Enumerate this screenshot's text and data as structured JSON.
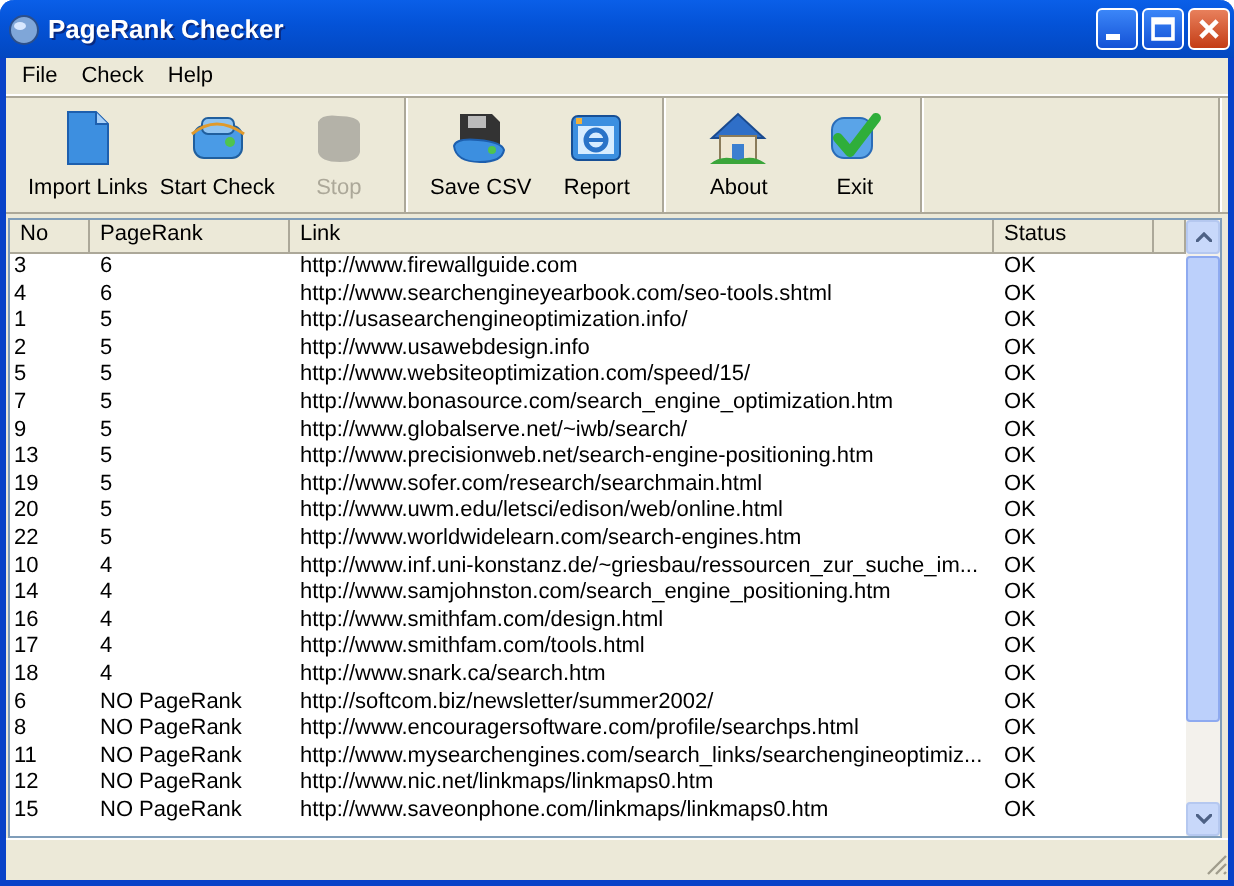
{
  "window": {
    "title": "PageRank Checker"
  },
  "menu": [
    "File",
    "Check",
    "Help"
  ],
  "toolbar": [
    [
      {
        "label": "Import Links",
        "disabled": false
      },
      {
        "label": "Start Check",
        "disabled": false
      },
      {
        "label": "Stop",
        "disabled": true
      }
    ],
    [
      {
        "label": "Save CSV",
        "disabled": false
      },
      {
        "label": "Report",
        "disabled": false
      }
    ],
    [
      {
        "label": "About",
        "disabled": false
      },
      {
        "label": "Exit",
        "disabled": false
      }
    ]
  ],
  "table": {
    "columns": [
      "No",
      "PageRank",
      "Link",
      "Status"
    ],
    "rows": [
      {
        "no": "3",
        "pagerank": "6",
        "link": "http://www.firewallguide.com",
        "status": "OK"
      },
      {
        "no": "4",
        "pagerank": "6",
        "link": "http://www.searchengineyearbook.com/seo-tools.shtml",
        "status": "OK"
      },
      {
        "no": "1",
        "pagerank": "5",
        "link": "http://usasearchengineoptimization.info/",
        "status": "OK"
      },
      {
        "no": "2",
        "pagerank": "5",
        "link": "http://www.usawebdesign.info",
        "status": "OK"
      },
      {
        "no": "5",
        "pagerank": "5",
        "link": "http://www.websiteoptimization.com/speed/15/",
        "status": "OK"
      },
      {
        "no": "7",
        "pagerank": "5",
        "link": "http://www.bonasource.com/search_engine_optimization.htm",
        "status": "OK"
      },
      {
        "no": "9",
        "pagerank": "5",
        "link": "http://www.globalserve.net/~iwb/search/",
        "status": "OK"
      },
      {
        "no": "13",
        "pagerank": "5",
        "link": "http://www.precisionweb.net/search-engine-positioning.htm",
        "status": "OK"
      },
      {
        "no": "19",
        "pagerank": "5",
        "link": "http://www.sofer.com/research/searchmain.html",
        "status": "OK"
      },
      {
        "no": "20",
        "pagerank": "5",
        "link": "http://www.uwm.edu/letsci/edison/web/online.html",
        "status": "OK"
      },
      {
        "no": "22",
        "pagerank": "5",
        "link": "http://www.worldwidelearn.com/search-engines.htm",
        "status": "OK"
      },
      {
        "no": "10",
        "pagerank": "4",
        "link": "http://www.inf.uni-konstanz.de/~griesbau/ressourcen_zur_suche_im...",
        "status": "OK"
      },
      {
        "no": "14",
        "pagerank": "4",
        "link": "http://www.samjohnston.com/search_engine_positioning.htm",
        "status": "OK"
      },
      {
        "no": "16",
        "pagerank": "4",
        "link": "http://www.smithfam.com/design.html",
        "status": "OK"
      },
      {
        "no": "17",
        "pagerank": "4",
        "link": "http://www.smithfam.com/tools.html",
        "status": "OK"
      },
      {
        "no": "18",
        "pagerank": "4",
        "link": "http://www.snark.ca/search.htm",
        "status": "OK"
      },
      {
        "no": "6",
        "pagerank": "NO PageRank",
        "link": "http://softcom.biz/newsletter/summer2002/",
        "status": "OK"
      },
      {
        "no": "8",
        "pagerank": "NO PageRank",
        "link": "http://www.encouragersoftware.com/profile/searchps.html",
        "status": "OK"
      },
      {
        "no": "11",
        "pagerank": "NO PageRank",
        "link": "http://www.mysearchengines.com/search_links/searchengineoptimiz...",
        "status": "OK"
      },
      {
        "no": "12",
        "pagerank": "NO PageRank",
        "link": "http://www.nic.net/linkmaps/linkmaps0.htm",
        "status": "OK"
      },
      {
        "no": "15",
        "pagerank": "NO PageRank",
        "link": "http://www.saveonphone.com/linkmaps/linkmaps0.htm",
        "status": "OK"
      }
    ]
  }
}
